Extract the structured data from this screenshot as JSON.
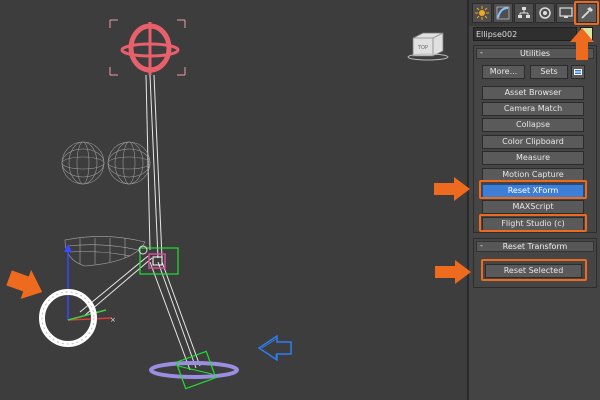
{
  "object_name": "Ellipse002",
  "colors": {
    "accent": "#ee6a1e",
    "selected_button": "#3d7fd6",
    "object_color": "#d8e6a4",
    "viewport_bg": "#3d3d3d"
  },
  "viewcube": {
    "face_label": "TOP"
  },
  "tabs": [
    {
      "name": "create",
      "icon": "sun-icon"
    },
    {
      "name": "modify",
      "icon": "modify-curve-icon"
    },
    {
      "name": "hierarchy",
      "icon": "hierarchy-icon"
    },
    {
      "name": "motion",
      "icon": "motion-icon"
    },
    {
      "name": "display",
      "icon": "display-icon"
    },
    {
      "name": "utilities",
      "icon": "hammer-icon",
      "active": true
    }
  ],
  "utilities": {
    "title": "Utilities",
    "collapse": "-",
    "more_label": "More...",
    "sets_label": "Sets",
    "buttons": [
      {
        "label": "Asset Browser"
      },
      {
        "label": "Camera Match"
      },
      {
        "label": "Collapse"
      },
      {
        "label": "Color Clipboard"
      },
      {
        "label": "Measure"
      },
      {
        "label": "Motion Capture"
      },
      {
        "label": "Reset XForm",
        "selected": true
      },
      {
        "label": "MAXScript"
      },
      {
        "label": "Flight Studio (c)"
      }
    ]
  },
  "reset_transform": {
    "title": "Reset Transform",
    "collapse": "-",
    "button_label": "Reset Selected"
  }
}
